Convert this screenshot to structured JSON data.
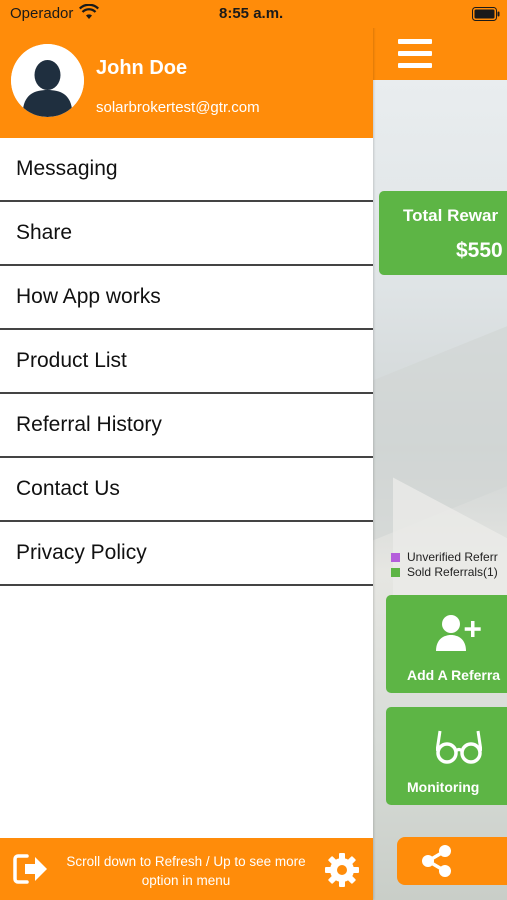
{
  "status_bar": {
    "carrier": "Operador",
    "time": "8:55 a.m."
  },
  "drawer": {
    "user": {
      "name": "John Doe",
      "email": "solarbrokertest@gtr.com"
    },
    "menu": [
      {
        "label": "Messaging"
      },
      {
        "label": "Share"
      },
      {
        "label": "How App works"
      },
      {
        "label": "Product List"
      },
      {
        "label": "Referral History"
      },
      {
        "label": "Contact Us"
      },
      {
        "label": "Privacy Policy"
      }
    ],
    "footer": {
      "line1": "Scroll down to Refresh / Up to see more",
      "line2": "option in menu"
    }
  },
  "background_app": {
    "total_rewards": {
      "title": "Total Rewar",
      "amount": "$550"
    },
    "legend": [
      {
        "label": "Unverified Referr",
        "color": "#B45EDB"
      },
      {
        "label": "Sold Referrals(1)",
        "color": "#5DB545"
      }
    ],
    "tiles": [
      {
        "label": "Add A Referra",
        "icon": "add-user-icon"
      },
      {
        "label": "Monitoring",
        "icon": "glasses-icon"
      }
    ],
    "share_icon": "share-icon"
  },
  "colors": {
    "brand_orange": "#FF8C0A",
    "green": "#5DB545"
  }
}
